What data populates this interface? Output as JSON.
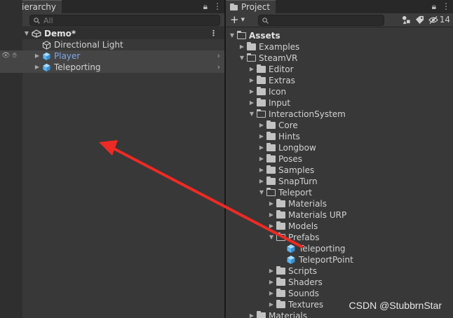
{
  "hierarchy": {
    "tab_label": "Hierarchy",
    "search_placeholder": "All",
    "scene_name": "Demo*",
    "items": [
      {
        "label": "Directional Light"
      },
      {
        "label": "Player"
      },
      {
        "label": "Teleporting"
      }
    ]
  },
  "project": {
    "tab_label": "Project",
    "hidden_count": "14",
    "tree": {
      "assets": "Assets",
      "examples": "Examples",
      "steamvr": "SteamVR",
      "editor": "Editor",
      "extras": "Extras",
      "icon": "Icon",
      "input": "Input",
      "interaction_system": "InteractionSystem",
      "core": "Core",
      "hints": "Hints",
      "longbow": "Longbow",
      "poses": "Poses",
      "samples": "Samples",
      "snapturn": "SnapTurn",
      "teleport": "Teleport",
      "materials": "Materials",
      "materials_urp": "Materials URP",
      "models": "Models",
      "prefabs": "Prefabs",
      "teleporting": "Teleporting",
      "teleport_point": "TeleportPoint",
      "scripts": "Scripts",
      "shaders": "Shaders",
      "sounds": "Sounds",
      "textures": "Textures",
      "materials2": "Materials"
    }
  },
  "watermark": "CSDN @StubbrnStar",
  "colors": {
    "panel_bg": "#383838",
    "selected_row": "#454545",
    "prefab_blue": "#5ab4f0",
    "player_text": "#80a8e8",
    "annotation_arrow": "#ee2a24"
  }
}
